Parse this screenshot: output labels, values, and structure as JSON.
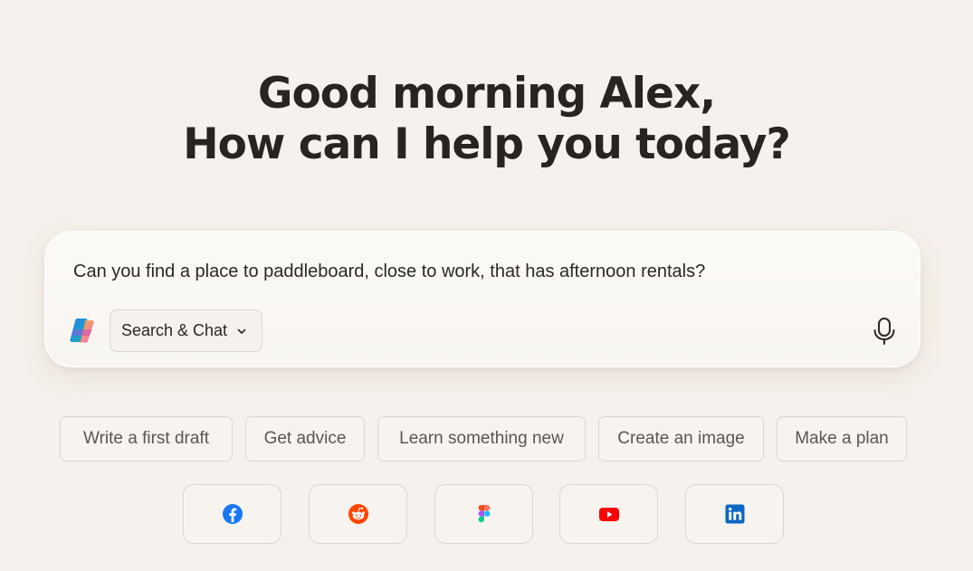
{
  "greeting": {
    "line1": "Good morning Alex,",
    "line2": "How can I help you today?"
  },
  "composer": {
    "prompt_text": "Can you find a place to paddleboard, close to work, that has afternoon rentals?",
    "mode_label": "Search & Chat",
    "logo_icon": "copilot-icon",
    "mic_icon": "microphone-icon"
  },
  "suggestions": [
    {
      "label": "Write a first draft"
    },
    {
      "label": "Get advice"
    },
    {
      "label": "Learn something new"
    },
    {
      "label": "Create an image"
    },
    {
      "label": "Make a plan"
    }
  ],
  "apps": [
    {
      "icon": "facebook-icon",
      "color": "#1877f2"
    },
    {
      "icon": "reddit-icon",
      "color": "#ff4500"
    },
    {
      "icon": "figma-icon",
      "color": "#a259ff"
    },
    {
      "icon": "youtube-icon",
      "color": "#ff0000"
    },
    {
      "icon": "linkedin-icon",
      "color": "#0a66c2"
    }
  ]
}
